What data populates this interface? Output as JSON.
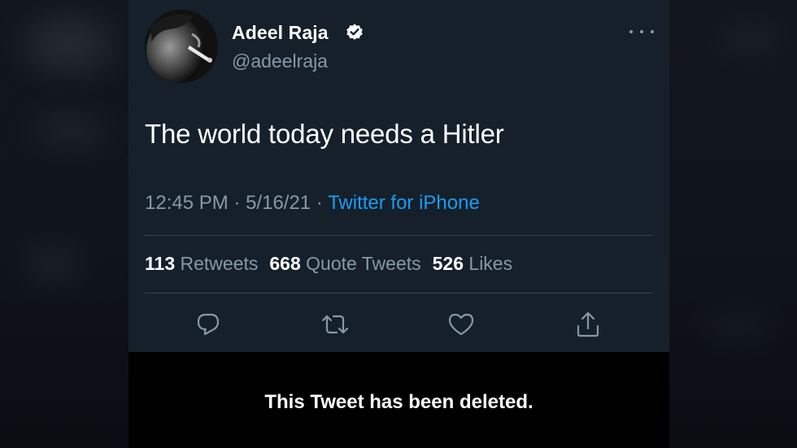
{
  "author": {
    "display_name": "Adeel Raja",
    "handle": "@adeelraja",
    "verified_icon": "verified-badge-icon",
    "avatar_icon": "profile-photo-avatar"
  },
  "tweet": {
    "text": "The world today needs a Hitler",
    "time": "12:45 PM",
    "separator": "·",
    "date": "5/16/21",
    "source": "Twitter for iPhone"
  },
  "stats": {
    "retweets_count": "113",
    "retweets_label": "Retweets",
    "quotes_count": "668",
    "quotes_label": "Quote Tweets",
    "likes_count": "526",
    "likes_label": "Likes"
  },
  "actions": {
    "reply_icon": "reply-icon",
    "retweet_icon": "retweet-icon",
    "like_icon": "like-icon",
    "share_icon": "share-icon",
    "more_icon": "more-options-icon"
  },
  "notice": {
    "deleted_text": "This Tweet has been deleted."
  },
  "colors": {
    "background": "#15202b",
    "accent": "#1d9bf0",
    "muted": "#8899a6",
    "divider": "#38444d"
  }
}
